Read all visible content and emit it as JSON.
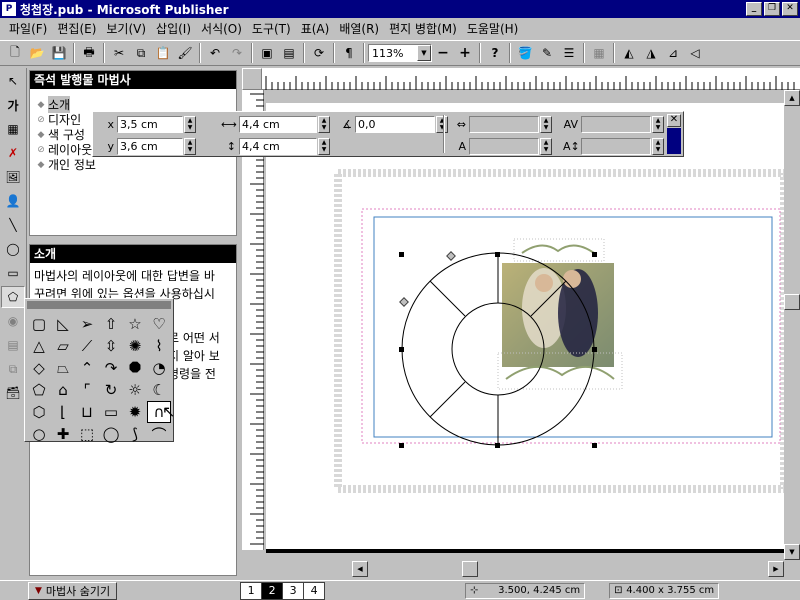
{
  "window": {
    "app_icon": "publisher-icon",
    "title": "청첩장.pub - Microsoft Publisher",
    "controls": [
      "minimize-icon",
      "restore-icon",
      "close-icon"
    ]
  },
  "menu": [
    "파일(F)",
    "편집(E)",
    "보기(V)",
    "삽입(I)",
    "서식(O)",
    "도구(T)",
    "표(A)",
    "배열(R)",
    "편지 병합(M)",
    "도움말(H)"
  ],
  "toolbar": {
    "zoom_value": "113%",
    "zoom_minus": "−",
    "zoom_plus": "+"
  },
  "wizard": {
    "title": "즉석 발행물 마법사",
    "items": [
      "소개",
      "디자인",
      "색 구성",
      "레이아웃",
      "개인 정보"
    ],
    "selected_index": 0
  },
  "intro": {
    "title": "소개",
    "text_line1": "마법사의 레이아웃에 대한 답변을 바",
    "text_line2": "꾸려면 위에 있는 옵션을 사용하십시",
    "text_line3": "로 어떤 서",
    "text_line4": "지 알아 보",
    "text_line5": "명령을 전"
  },
  "measurements": {
    "x_label": "x",
    "x_value": "3,5 cm",
    "y_label": "y",
    "y_value": "3,6 cm",
    "width_value": "4,4 cm",
    "height_value": "4,4 cm",
    "angle_value": "0,0",
    "char_spacing_value": "",
    "tracking_value": "",
    "text_scale_value": "",
    "line_spacing_value": ""
  },
  "status": {
    "hide_wizard": "마법사 숨기기",
    "pages": [
      "1",
      "2",
      "3",
      "4"
    ],
    "current_page": "2",
    "position": "3.500, 4.245 cm",
    "size": "4.400 x 3.755 cm"
  },
  "colors": {
    "titlebar": "#000080",
    "face": "#c0c0c0",
    "margin_guide_pink": "#e080c0",
    "margin_guide_blue": "#4080c0"
  }
}
